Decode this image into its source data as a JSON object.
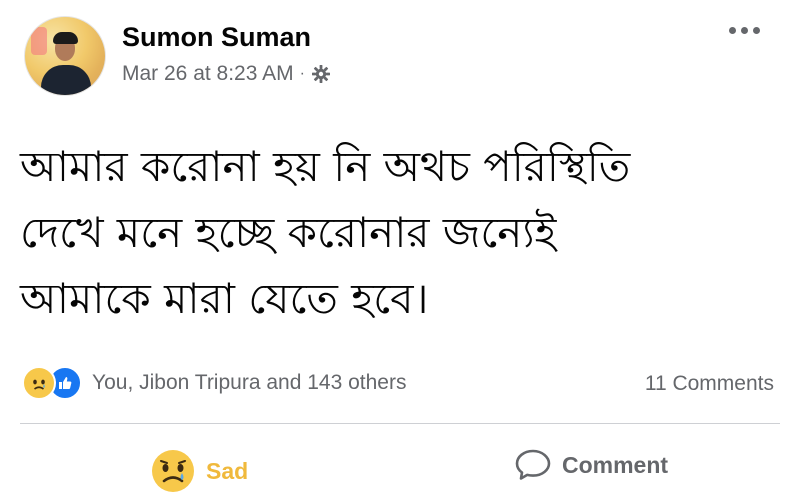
{
  "post": {
    "author": "Sumon Suman",
    "timestamp": "Mar 26 at 8:23 AM",
    "separator": "·",
    "privacy_icon": "gear-icon",
    "text_lines": [
      "আমার করোনা হয় নি অথচ পরিস্থিতি",
      "দেখে মনে হচ্ছে করোনার জন্যেই",
      "আমাকে মারা যেতে হবে।"
    ]
  },
  "reactions": {
    "icons": [
      "sad-reaction-icon",
      "like-reaction-icon"
    ],
    "summary": "You, Jibon Tripura and 143 others",
    "comments_count": "11 Comments"
  },
  "actions": {
    "sad_label": "Sad",
    "comment_label": "Comment"
  },
  "colors": {
    "sad_accent": "#f0b93c",
    "like_blue": "#1877f2",
    "secondary_text": "#65676b"
  }
}
